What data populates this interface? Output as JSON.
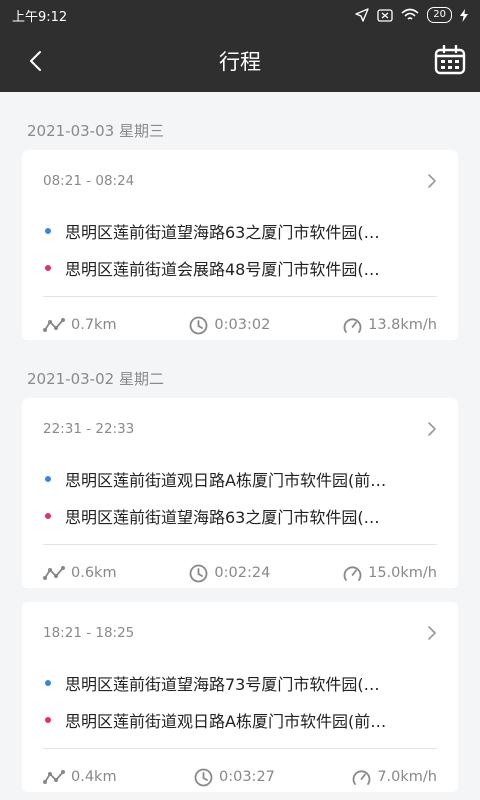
{
  "status_bar": {
    "time": "上午9:12",
    "battery": "20"
  },
  "header": {
    "title": "行程"
  },
  "sections": [
    {
      "date": "2021-03-03 星期三",
      "trips": [
        {
          "time_range": "08:21 - 08:24",
          "start": "思明区莲前街道望海路63之厦门市软件园(…",
          "end": "思明区莲前街道会展路48号厦门市软件园(…",
          "distance": "0.7km",
          "duration": "0:03:02",
          "speed": "13.8km/h"
        }
      ]
    },
    {
      "date": "2021-03-02 星期二",
      "trips": [
        {
          "time_range": "22:31 - 22:33",
          "start": "思明区莲前街道观日路A栋厦门市软件园(前…",
          "end": "思明区莲前街道望海路63之厦门市软件园(…",
          "distance": "0.6km",
          "duration": "0:02:24",
          "speed": "15.0km/h"
        },
        {
          "time_range": "18:21 - 18:25",
          "start": "思明区莲前街道望海路73号厦门市软件园(…",
          "end": "思明区莲前街道观日路A栋厦门市软件园(前…",
          "distance": "0.4km",
          "duration": "0:03:27",
          "speed": "7.0km/h"
        }
      ]
    }
  ],
  "colors": {
    "header_bg": "#2f2f2f",
    "start_dot": "#3a86d8",
    "end_dot": "#e0307a",
    "page_bg": "#f4f5f7"
  },
  "icons": {
    "back": "chevron-left-icon",
    "calendar": "calendar-icon",
    "distance": "route-icon",
    "duration": "clock-icon",
    "speed": "speedometer-icon"
  }
}
